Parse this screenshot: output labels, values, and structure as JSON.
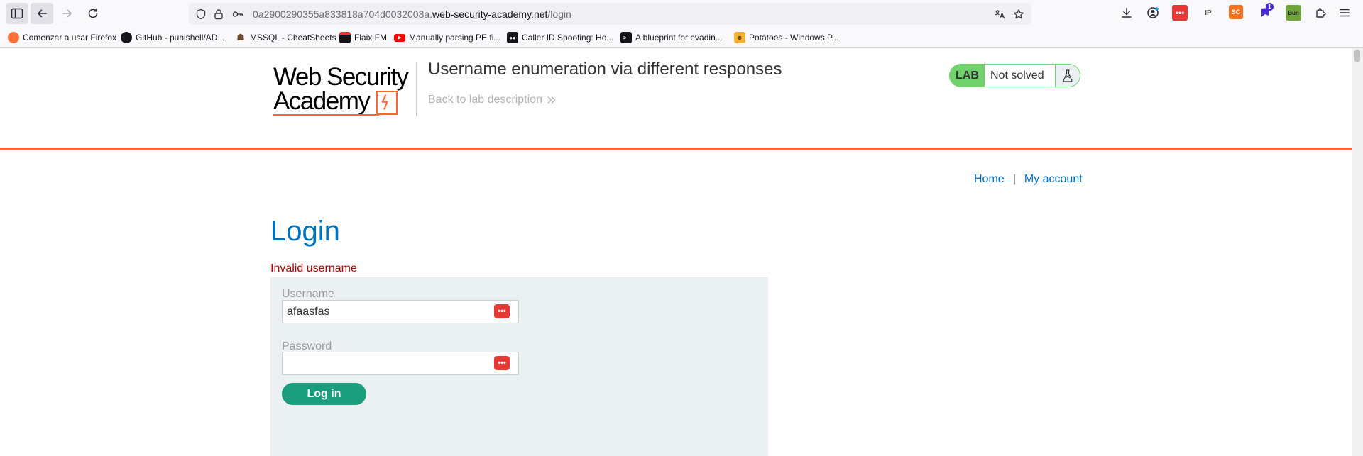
{
  "browser": {
    "url_prefix": "0a2900290355a833818a704d0032008a.",
    "url_host": "web-security-academy.net",
    "url_path": "/login",
    "bookmarks": [
      {
        "label": "Comenzar a usar Firefox",
        "icon": "firefox-icon",
        "color": "#ff7139"
      },
      {
        "label": "GitHub - punishell/AD...",
        "icon": "github-icon",
        "color": "#15141a"
      },
      {
        "label": "MSSQL - CheatSheets",
        "icon": "figure-icon",
        "color": "#6b4a2b"
      },
      {
        "label": "Flaix FM",
        "icon": "flaix-icon",
        "color": "#15141a"
      },
      {
        "label": "Manually parsing PE fi...",
        "icon": "youtube-icon",
        "color": "#ff0000"
      },
      {
        "label": "Caller ID Spoofing: Ho...",
        "icon": "medium-icon",
        "color": "#15141a"
      },
      {
        "label": "A blueprint for evadin...",
        "icon": "terminal-icon",
        "color": "#15141a"
      },
      {
        "label": "Potatoes - Windows P...",
        "icon": "potato-icon",
        "color": "#f2b134"
      }
    ],
    "extensions": {
      "ip_label": "IP",
      "sc_label": "SC",
      "badge_count": "1",
      "bun_label": "Bun"
    }
  },
  "header": {
    "logo_line1": "Web Security",
    "logo_line2": "Academy",
    "lab_title": "Username enumeration via different responses",
    "back_link": "Back to lab description",
    "lab_badge": "LAB",
    "lab_status": "Not solved"
  },
  "nav": {
    "home": "Home",
    "separator": "|",
    "account": "My account"
  },
  "login": {
    "title": "Login",
    "error": "Invalid username",
    "username_label": "Username",
    "username_value": "afaasfas",
    "password_label": "Password",
    "password_value": "",
    "submit_label": "Log in"
  },
  "colors": {
    "accent_orange": "#ff6633",
    "link_blue": "#0071bc",
    "lab_green": "#70d16d",
    "button_teal": "#1a9e7e",
    "error_red": "#ae0000"
  }
}
